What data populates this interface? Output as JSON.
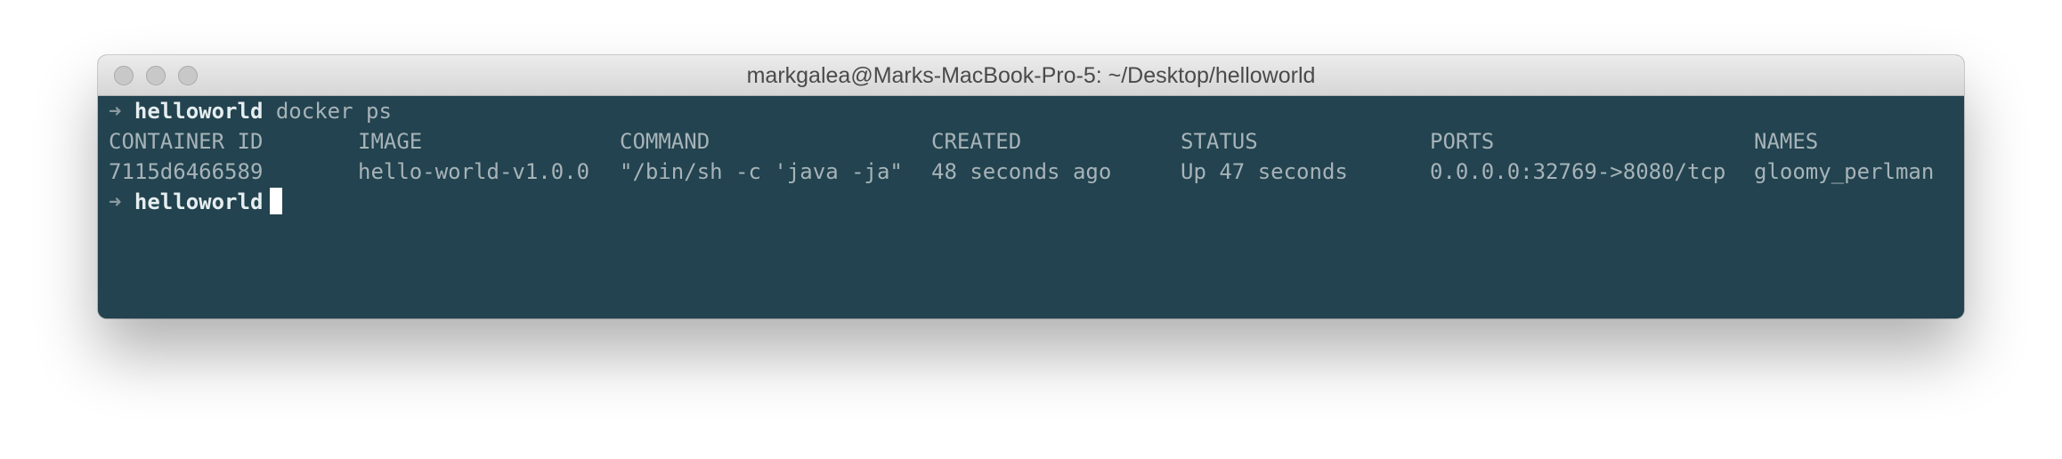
{
  "window": {
    "title": "markgalea@Marks-MacBook-Pro-5: ~/Desktop/helloworld"
  },
  "terminal": {
    "prompt_arrow": "➜",
    "prompt_dir": "helloworld",
    "command": "docker ps",
    "table": {
      "headers": [
        "CONTAINER ID",
        "IMAGE",
        "COMMAND",
        "CREATED",
        "STATUS",
        "PORTS",
        "NAMES"
      ],
      "rows": [
        [
          "7115d6466589",
          "hello-world-v1.0.0",
          "\"/bin/sh -c 'java -ja\"",
          "48 seconds ago",
          "Up 47 seconds",
          "0.0.0.0:32769->8080/tcp",
          "gloomy_perlman"
        ]
      ]
    }
  },
  "colors": {
    "terminal_bg": "#22434f",
    "text": "#a7b3b8",
    "prompt_dir": "#e6eef0",
    "cursor": "#ffffff"
  }
}
